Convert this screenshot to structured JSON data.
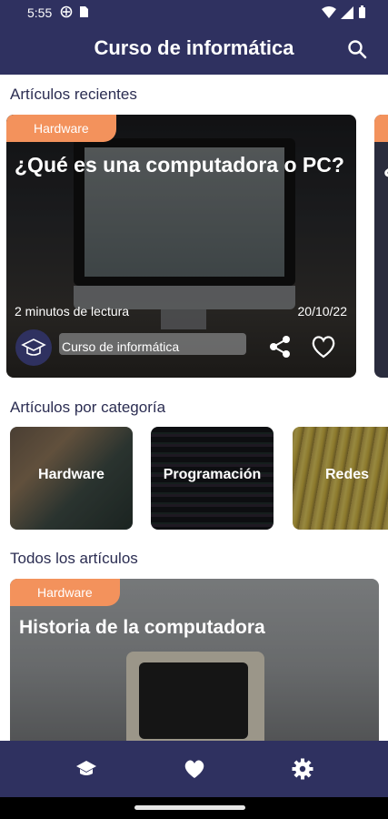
{
  "status_bar": {
    "time": "5:55"
  },
  "app_bar": {
    "title": "Curso de informática"
  },
  "sections": {
    "recent": "Artículos recientes",
    "by_category": "Artículos por categoría",
    "all": "Todos los artículos"
  },
  "featured": {
    "tag": "Hardware",
    "title": "¿Qué es una computadora o PC?",
    "read_time": "2 minutos de lectura",
    "date": "20/10/22",
    "author": "Curso de informática"
  },
  "peek_card": {
    "title_start": "¿"
  },
  "categories": [
    {
      "label": "Hardware"
    },
    {
      "label": "Programación"
    },
    {
      "label": "Redes"
    }
  ],
  "article": {
    "tag": "Hardware",
    "title": "Historia de la computadora"
  },
  "bottom_nav": {
    "items": [
      "school-icon",
      "heart-icon",
      "settings-icon"
    ]
  },
  "colors": {
    "primary": "#2f3160",
    "accent": "#f3925c"
  }
}
